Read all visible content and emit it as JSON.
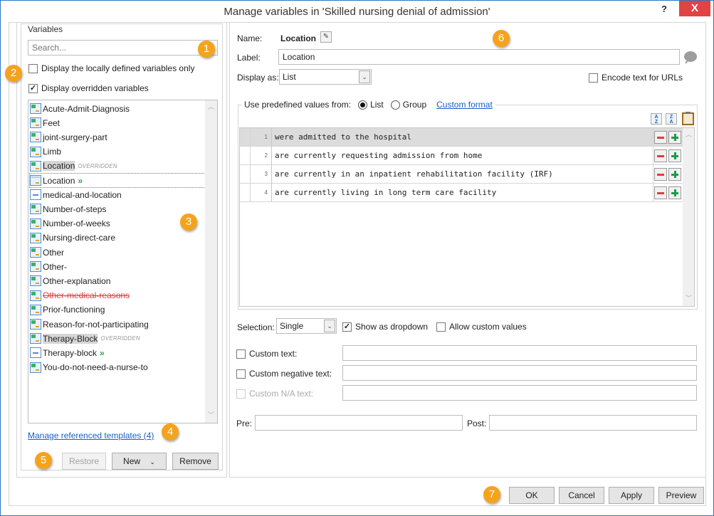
{
  "window": {
    "title": "Manage variables in 'Skilled nursing denial of admission'",
    "help_label": "?",
    "close_label": "X"
  },
  "variables": {
    "group_label": "Variables",
    "search_placeholder": "Search...",
    "local_only_label": "Display the locally defined variables only",
    "local_only_checked": false,
    "overridden_label": "Display overridden variables",
    "overridden_checked": true,
    "items": [
      {
        "name": "Acute-Admit-Diagnosis",
        "icon": "variable-icon"
      },
      {
        "name": "Feet",
        "icon": "variable-icon"
      },
      {
        "name": "joint-surgery-part",
        "icon": "variable-icon"
      },
      {
        "name": "Limb",
        "icon": "variable-icon"
      },
      {
        "name": "Location",
        "icon": "variable-icon",
        "tag": "OVERRIDDEN"
      },
      {
        "name": "Location",
        "icon": "variable-plain-icon",
        "suffix": "»",
        "selected": true
      },
      {
        "name": "medical-and-location",
        "icon": "group-icon"
      },
      {
        "name": "Number-of-steps",
        "icon": "variable-icon"
      },
      {
        "name": "Number-of-weeks",
        "icon": "variable-icon"
      },
      {
        "name": "Nursing-direct-care",
        "icon": "variable-icon"
      },
      {
        "name": "Other",
        "icon": "variable-icon"
      },
      {
        "name": "Other-",
        "icon": "variable-icon"
      },
      {
        "name": "Other-explanation",
        "icon": "variable-icon"
      },
      {
        "name": "Other-medical-reasons",
        "icon": "variable-icon",
        "strikethrough": true
      },
      {
        "name": "Prior-functioning",
        "icon": "variable-icon"
      },
      {
        "name": "Reason-for-not-participating",
        "icon": "variable-icon"
      },
      {
        "name": "Therapy-Block",
        "icon": "variable-icon",
        "tag": "OVERRIDDEN"
      },
      {
        "name": "Therapy-block",
        "icon": "group-icon",
        "suffix": "»"
      },
      {
        "name": "You-do-not-need-a-nurse-to",
        "icon": "variable-icon"
      }
    ],
    "manage_link": "Manage referenced templates (4)",
    "restore_label": "Restore",
    "new_label": "New",
    "remove_label": "Remove"
  },
  "detail": {
    "name_label": "Name:",
    "name_value": "Location",
    "label_label": "Label:",
    "label_value": "Location",
    "display_as_label": "Display as:",
    "display_as_value": "List",
    "encode_label": "Encode text for URLs",
    "encode_checked": false,
    "predefined_label": "Use predefined values from:",
    "radio_list": "List",
    "radio_group": "Group",
    "radio_selected": "List",
    "custom_format_link": "Custom format",
    "values": [
      {
        "num": "1",
        "text": "were admitted to the hospital",
        "selected": true
      },
      {
        "num": "2",
        "text": "are currently requesting admission from home"
      },
      {
        "num": "3",
        "text": "are currently in an inpatient rehabilitation facility (IRF)"
      },
      {
        "num": "4",
        "text": "are currently living in long term care facility"
      }
    ],
    "selection_label": "Selection:",
    "selection_value": "Single",
    "show_dropdown_label": "Show as dropdown",
    "show_dropdown_checked": true,
    "allow_custom_label": "Allow custom values",
    "allow_custom_checked": false,
    "custom_text_label": "Custom text:",
    "custom_text_value": "",
    "custom_negative_label": "Custom negative text:",
    "custom_negative_value": "",
    "custom_na_label": "Custom N/A text:",
    "custom_na_value": "",
    "pre_label": "Pre:",
    "pre_value": "",
    "post_label": "Post:",
    "post_value": ""
  },
  "footer": {
    "ok_label": "OK",
    "cancel_label": "Cancel",
    "apply_label": "Apply",
    "preview_label": "Preview"
  },
  "callouts": [
    "1",
    "2",
    "3",
    "4",
    "5",
    "6",
    "7"
  ],
  "colors": {
    "callout": "#f5a31c",
    "close": "#e04343",
    "link": "#1a5fc5",
    "window_border": "#2b79c2"
  }
}
